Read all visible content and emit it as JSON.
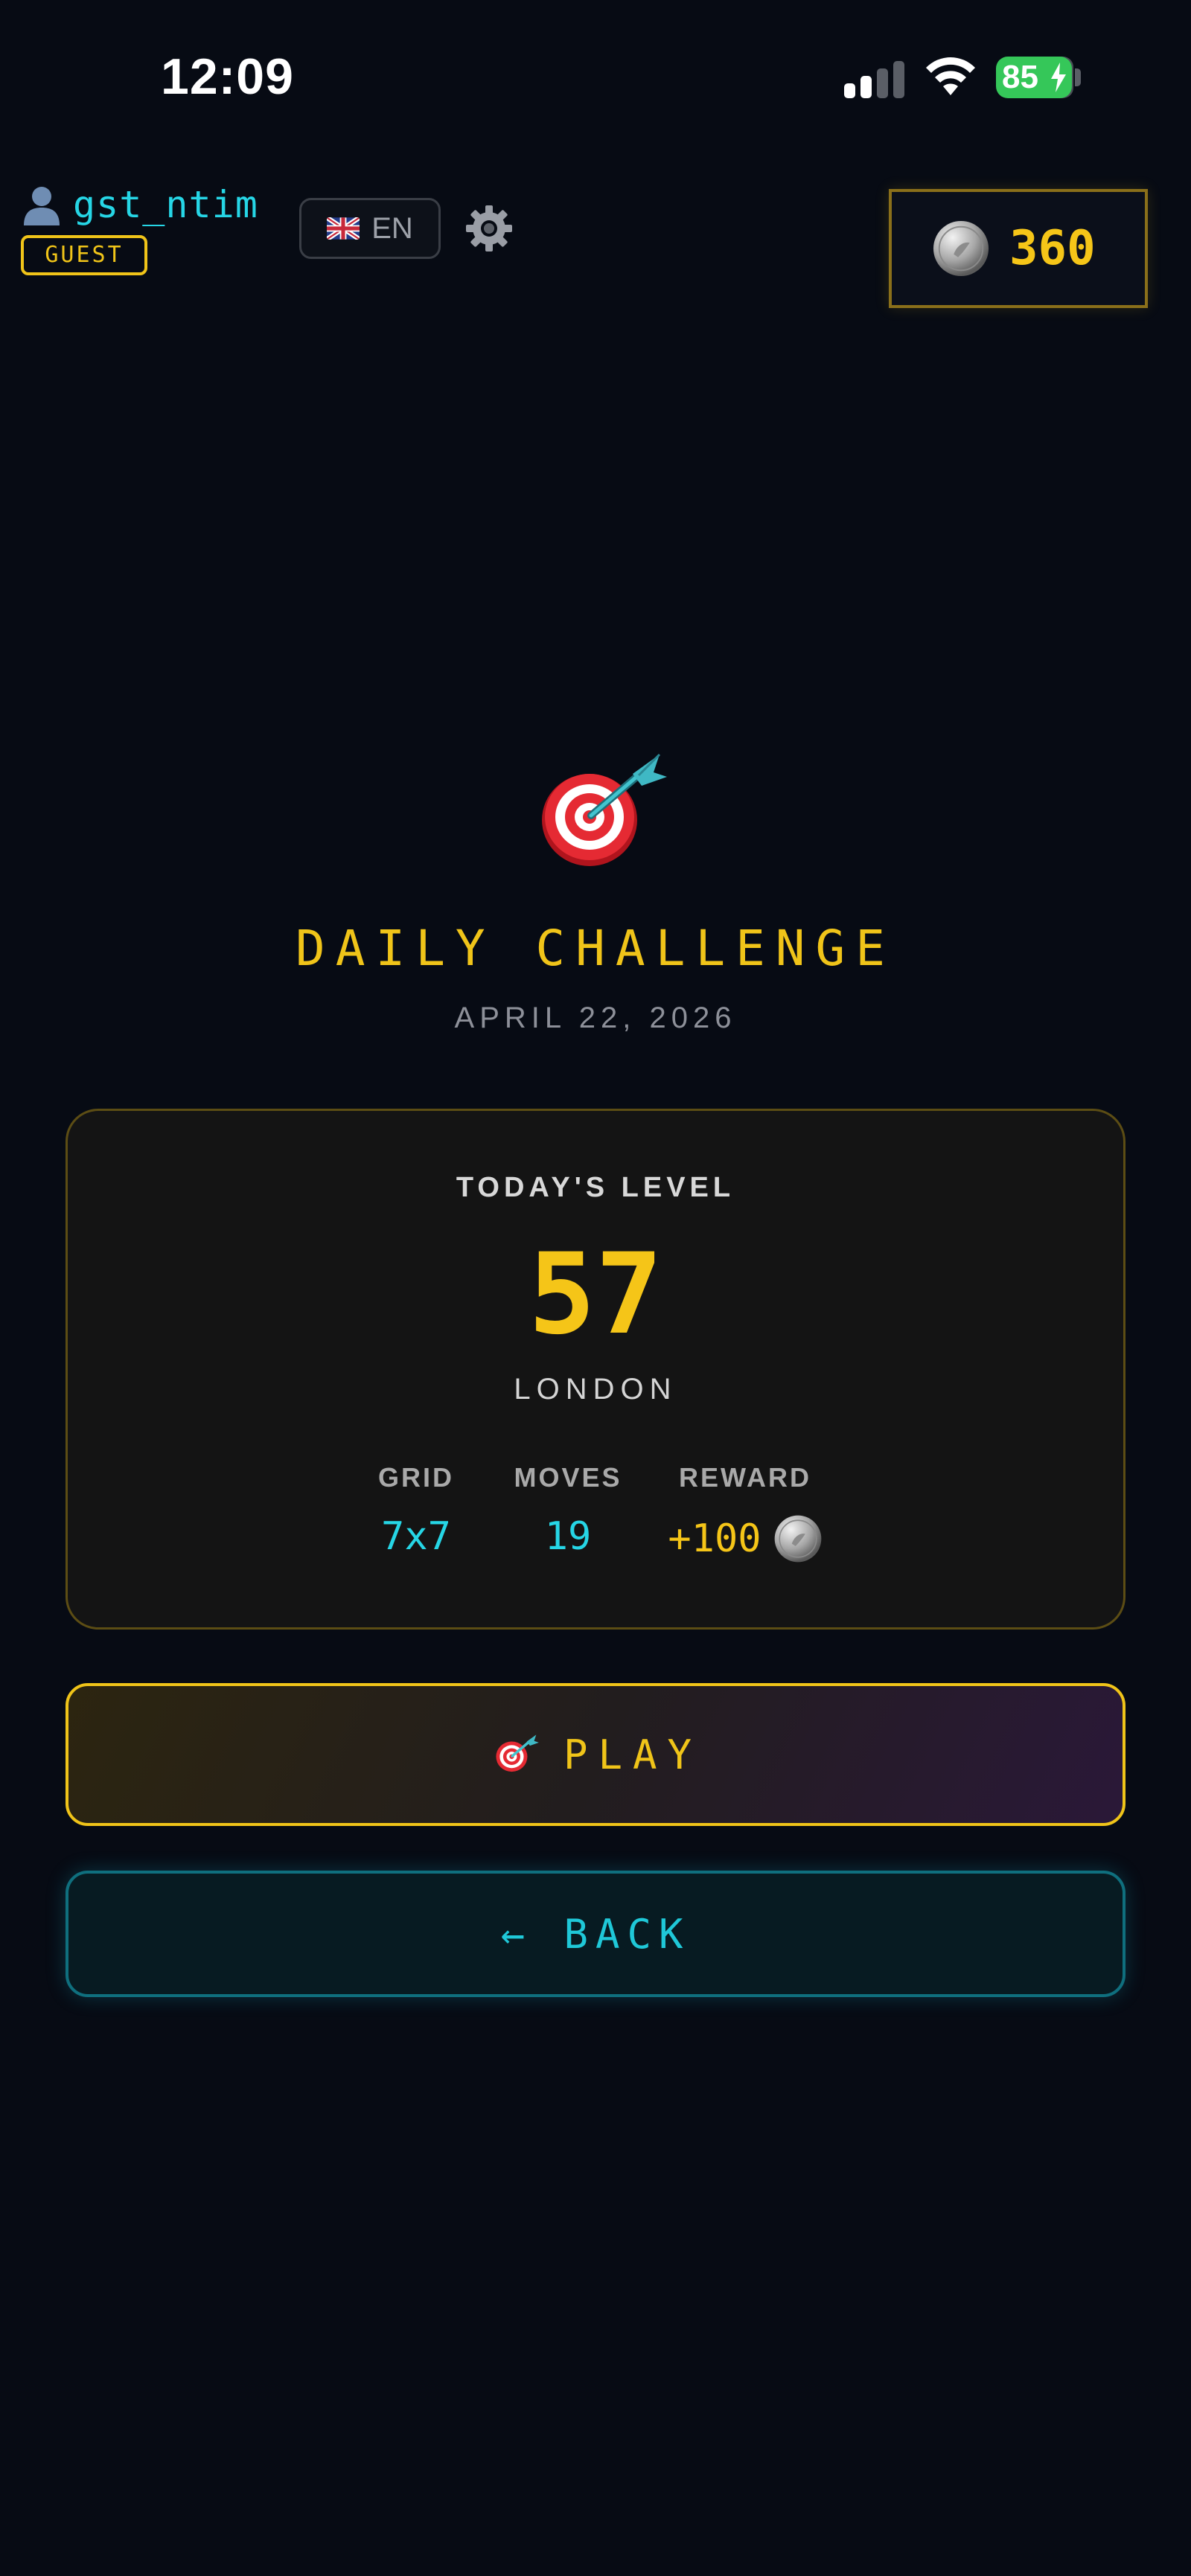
{
  "status_bar": {
    "time": "12:09",
    "battery": "85",
    "icons": [
      "cellular-signal-icon",
      "wifi-icon",
      "battery-charging-icon"
    ]
  },
  "header": {
    "user_icon": "user-silhouette-icon",
    "username": "gst_ntim",
    "badge": "GUEST",
    "language": {
      "flag": "uk-flag-icon",
      "code": "EN"
    },
    "settings_icon": "gear-icon",
    "coins": {
      "icon": "silver-coin-icon",
      "amount": "360"
    }
  },
  "hero": {
    "icon": "dart-target-icon",
    "title": "DAILY CHALLENGE",
    "date": "APRIL 22, 2026"
  },
  "level_card": {
    "label": "TODAY'S LEVEL",
    "level_number": "57",
    "city": "LONDON",
    "stats": [
      {
        "label": "GRID",
        "value": "7x7"
      },
      {
        "label": "MOVES",
        "value": "19"
      },
      {
        "label": "REWARD",
        "value": "+100",
        "icon": "silver-coin-icon"
      }
    ]
  },
  "buttons": {
    "play": {
      "icon": "dart-target-icon",
      "label": "PLAY"
    },
    "back": {
      "label": "← BACK"
    }
  },
  "colors": {
    "background": "#070b14",
    "gold_accent": "#f0c419",
    "cyan_accent": "#26d6e6",
    "battery_green": "#35c759"
  }
}
